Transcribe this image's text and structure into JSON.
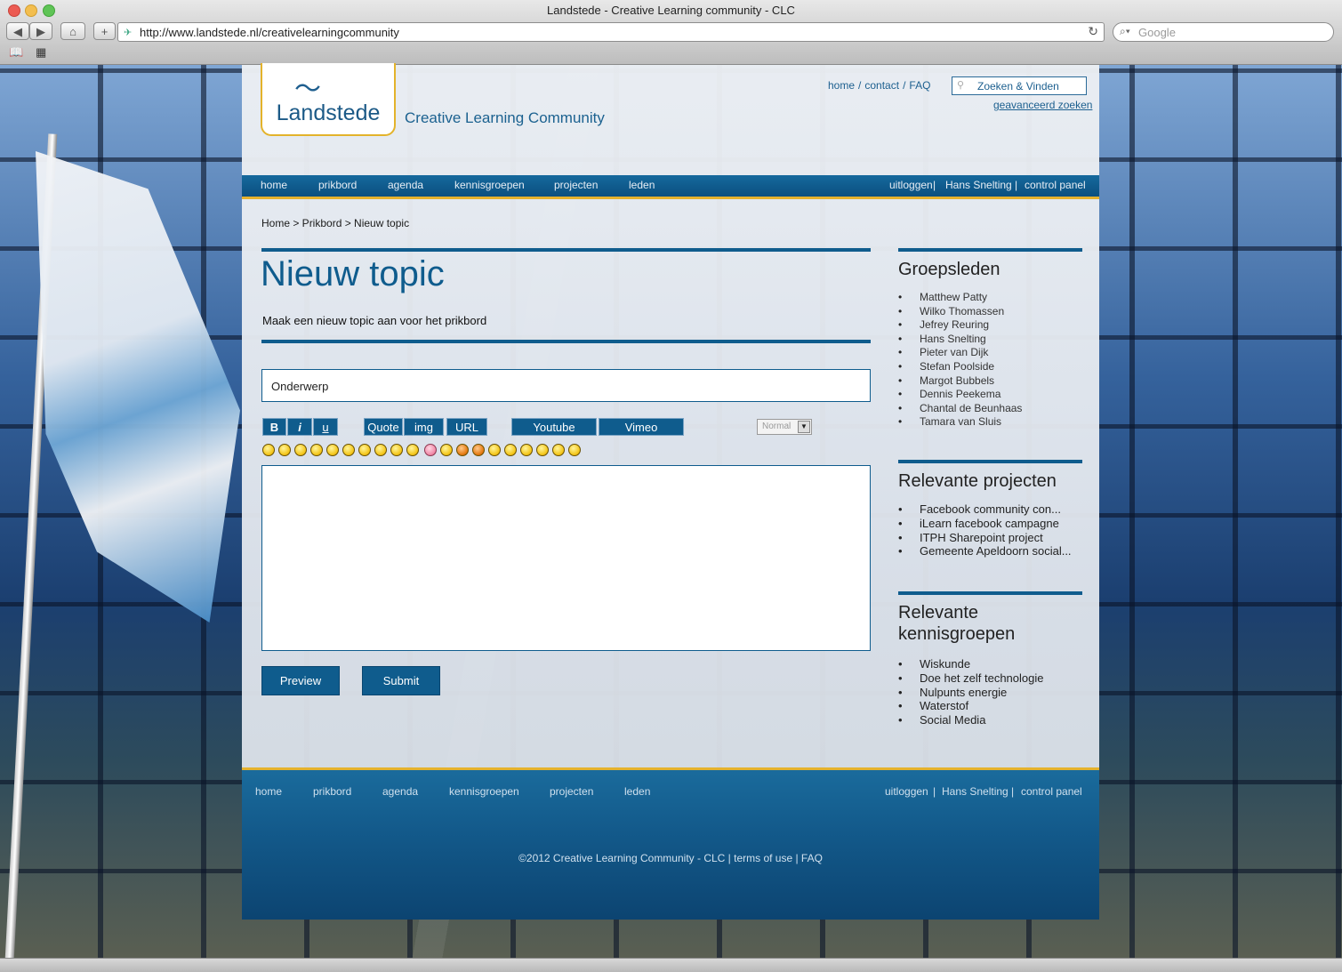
{
  "browser": {
    "window_title": "Landstede - Creative Learning community - CLC",
    "url": "http://www.landstede.nl/creativelearningcommunity",
    "search_placeholder": "Google"
  },
  "header": {
    "logo_text": "Landstede",
    "site_subtitle": "Creative Learning Community",
    "top_links": [
      "home",
      "contact",
      "FAQ"
    ],
    "search_placeholder": "Zoeken & Vinden",
    "advanced_search": "geavanceerd zoeken"
  },
  "nav": {
    "left": [
      "home",
      "prikbord",
      "agenda",
      "kennisgroepen",
      "projecten",
      "leden"
    ],
    "right": [
      "uitloggen",
      "Hans Snelting",
      "control panel"
    ]
  },
  "breadcrumb": "Home > Prikbord > Nieuw topic",
  "main": {
    "title": "Nieuw topic",
    "subtitle": "Maak een nieuw topic aan voor het prikbord",
    "subject_placeholder": "Onderwerp",
    "toolbar": {
      "bold": "B",
      "italic": "i",
      "underline": "u",
      "quote": "Quote",
      "img": "img",
      "url": "URL",
      "youtube": "Youtube",
      "vimeo": "Vimeo",
      "size_value": "Normal"
    },
    "preview_label": "Preview",
    "submit_label": "Submit"
  },
  "sidebar": {
    "members_title": "Groepsleden",
    "members": [
      "Matthew Patty",
      "Wilko Thomassen",
      "Jefrey Reuring",
      "Hans Snelting",
      "Pieter van Dijk",
      "Stefan Poolside",
      "Margot Bubbels",
      "Dennis Peekema",
      "Chantal de Beunhaas",
      "Tamara van Sluis"
    ],
    "projects_title": "Relevante projecten",
    "projects": [
      "Facebook community con...",
      "iLearn facebook campagne",
      "ITPH Sharepoint project",
      "Gemeente Apeldoorn social..."
    ],
    "groups_title_line1": "Relevante",
    "groups_title_line2": "kennisgroepen",
    "groups": [
      "Wiskunde",
      "Doe het zelf technologie",
      "Nulpunts energie",
      "Waterstof",
      "Social Media"
    ]
  },
  "footer": {
    "left": [
      "home",
      "prikbord",
      "agenda",
      "kennisgroepen",
      "projecten",
      "leden"
    ],
    "right": [
      "uitloggen",
      "Hans Snelting",
      "control panel"
    ],
    "copyright": "©2012 Creative Learning Community - CLC  |  terms of use | FAQ"
  },
  "colors": {
    "brand_blue": "#0f5c8d",
    "accent_gold": "#e5b22d"
  }
}
